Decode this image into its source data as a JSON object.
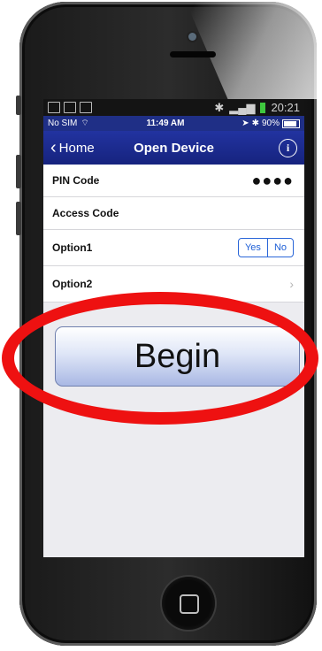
{
  "android_status": {
    "time": "20:21"
  },
  "ios_status": {
    "carrier": "No SIM",
    "time": "11:49 AM",
    "battery": "90%"
  },
  "nav": {
    "back_label": "Home",
    "title": "Open Device",
    "info_glyph": "i"
  },
  "rows": [
    {
      "label": "PIN Code",
      "value": "●●●●"
    },
    {
      "label": "Access Code",
      "value": ""
    },
    {
      "label": "Option1",
      "segment": [
        "Yes",
        "No"
      ]
    },
    {
      "label": "Option2"
    }
  ],
  "begin_button": {
    "label": "Begin"
  },
  "icons": [
    "back-chevron-icon",
    "info-icon",
    "chevron-right-icon",
    "battery-icon",
    "bluetooth-icon",
    "signal-icon",
    "wifi-icon"
  ],
  "colors": {
    "nav": "#1f2f86",
    "highlight": "#ee1111",
    "segment": "#2a66d8"
  }
}
